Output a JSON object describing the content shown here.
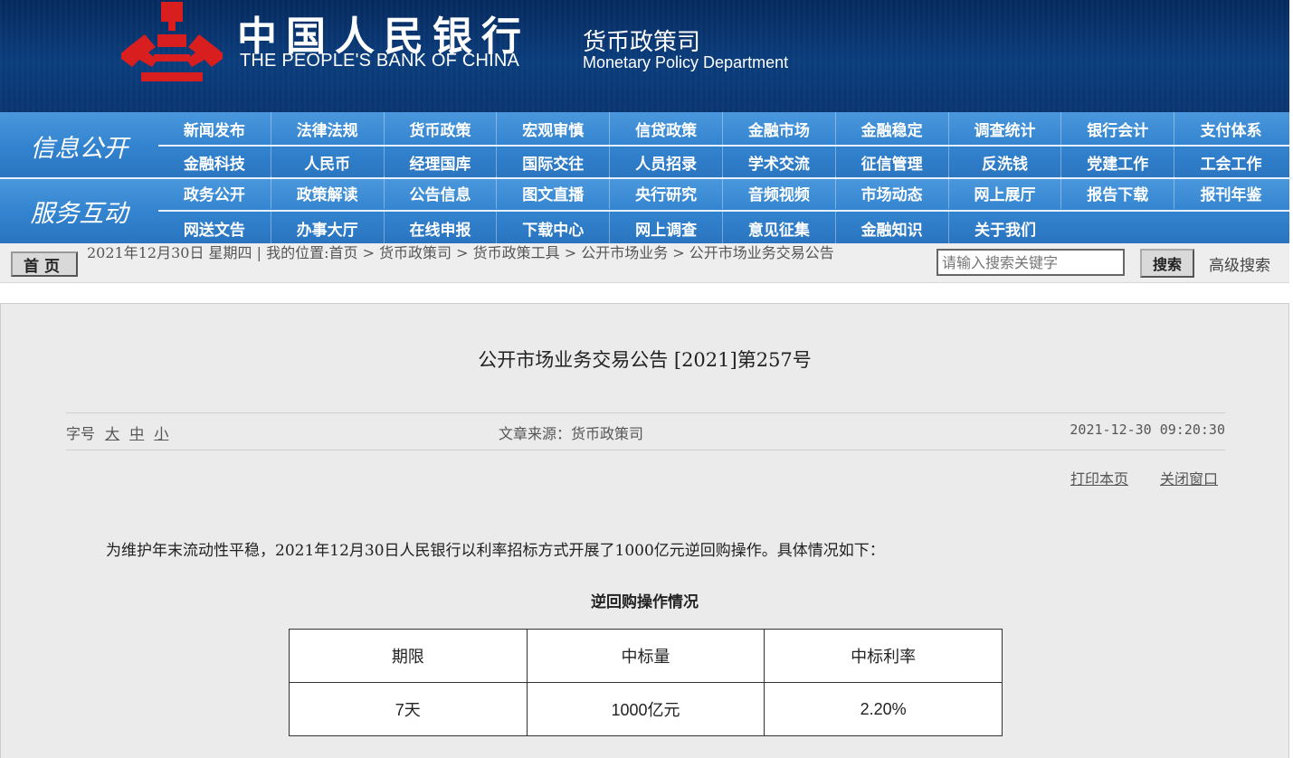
{
  "header": {
    "cn_title": "中国人民银行",
    "en_title": "THE PEOPLE'S BANK OF CHINA",
    "dept_cn": "货币政策司",
    "dept_en": "Monetary Policy Department"
  },
  "nav": {
    "section1_label": "信息公开",
    "section1_row1": [
      "新闻发布",
      "法律法规",
      "货币政策",
      "宏观审慎",
      "信贷政策",
      "金融市场",
      "金融稳定",
      "调查统计",
      "银行会计",
      "支付体系"
    ],
    "section1_row2": [
      "金融科技",
      "人民币",
      "经理国库",
      "国际交往",
      "人员招录",
      "学术交流",
      "征信管理",
      "反洗钱",
      "党建工作",
      "工会工作"
    ],
    "section2_label": "服务互动",
    "section2_row1": [
      "政务公开",
      "政策解读",
      "公告信息",
      "图文直播",
      "央行研究",
      "音频视频",
      "市场动态",
      "网上展厅",
      "报告下载",
      "报刊年鉴"
    ],
    "section2_row2": [
      "网送文告",
      "办事大厅",
      "在线申报",
      "下载中心",
      "网上调查",
      "意见征集",
      "金融知识",
      "关于我们"
    ]
  },
  "crumbbar": {
    "home_label": "首页",
    "text": "2021年12月30日 星期四 | 我的位置:首页 > 货币政策司 > 货币政策工具 > 公开市场业务 > 公开市场业务交易公告",
    "search_placeholder": "请输入搜索关键字",
    "search_label": "搜索",
    "advanced_search_label": "高级搜索"
  },
  "article": {
    "title": "公开市场业务交易公告 [2021]第257号",
    "fontsize_label": "字号",
    "fontsize_large": "大",
    "fontsize_medium": "中",
    "fontsize_small": "小",
    "source": "文章来源：货币政策司",
    "date": "2021-12-30 09:20:30",
    "print_label": "打印本页",
    "close_label": "关闭窗口",
    "body": "为维护年末流动性平稳，2021年12月30日人民银行以利率招标方式开展了1000亿元逆回购操作。具体情况如下：",
    "table_title": "逆回购操作情况",
    "table_headers": [
      "期限",
      "中标量",
      "中标利率"
    ],
    "table_rows": [
      [
        "7天",
        "1000亿元",
        "2.20%"
      ]
    ]
  },
  "colors": {
    "header_bg": "#0b3d7c",
    "nav_bg": "#3384d0",
    "logo_red": "#d81e1e",
    "content_bg": "#ebebeb"
  }
}
